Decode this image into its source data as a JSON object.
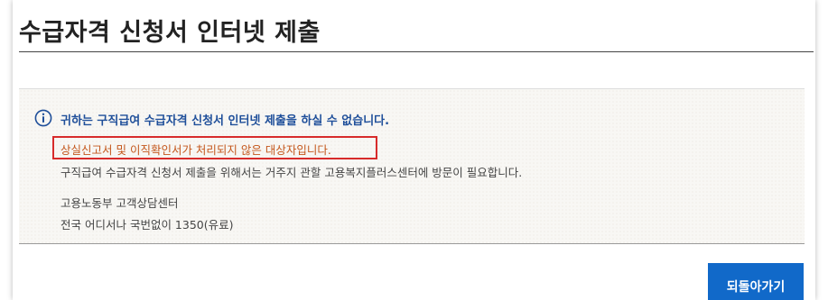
{
  "page": {
    "title": "수급자격 신청서 인터넷 제출"
  },
  "notice": {
    "icon": "info-icon",
    "headline": "귀하는 구직급여 수급자격 신청서 인터넷 제출을 하실 수 없습니다.",
    "alert": "상실신고서 및 이직확인서가 처리되지 않은 대상자입니다.",
    "alert_color": "#c4571c",
    "alert_border_color": "#d72b2b",
    "lines": [
      "구직급여 수급자격 신청서 제출을 위해서는 거주지 관할 고용복지플러스센터에 방문이 필요합니다.",
      "고용노동부 고객상담센터",
      "전국 어디서나 국번없이 1350(유료)"
    ]
  },
  "actions": {
    "back_label": "되돌아가기",
    "back_color": "#1169c9"
  }
}
